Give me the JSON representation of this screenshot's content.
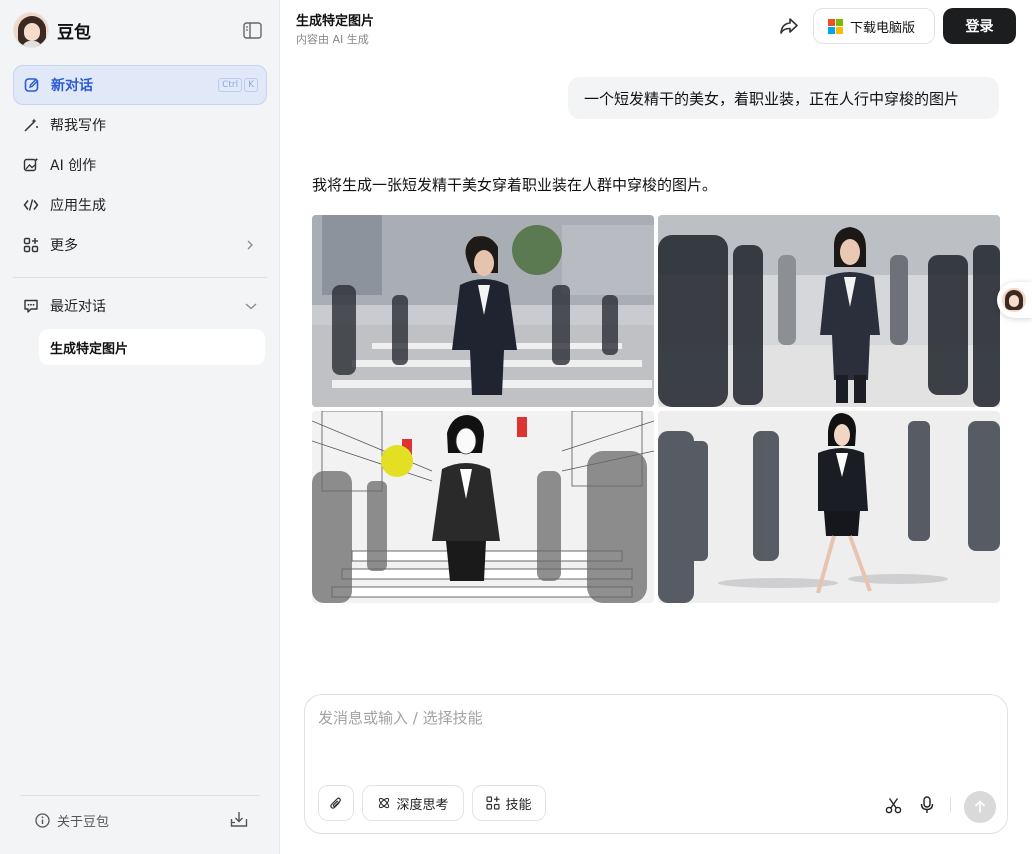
{
  "app": {
    "name": "豆包"
  },
  "sidebar": {
    "items": [
      {
        "label": "新对话",
        "icon": "new-chat-icon",
        "active": true,
        "shortcut": [
          "Ctrl",
          "K"
        ]
      },
      {
        "label": "帮我写作",
        "icon": "writing-wand-icon"
      },
      {
        "label": "AI 创作",
        "icon": "image-create-icon"
      },
      {
        "label": "应用生成",
        "icon": "code-icon"
      },
      {
        "label": "更多",
        "icon": "grid-plus-icon"
      }
    ],
    "recent_label": "最近对话",
    "recent_items": [
      {
        "label": "生成特定图片",
        "selected": true
      }
    ],
    "about_label": "关于豆包"
  },
  "header": {
    "title": "生成特定图片",
    "subtitle": "内容由 AI 生成",
    "download_label": "下载电脑版",
    "login_label": "登录"
  },
  "chat": {
    "user_message": "一个短发精干的美女，着职业装，正在人行中穿梭的图片",
    "assistant_message": "我将生成一张短发精干美女穿着职业装在人群中穿梭的图片。",
    "images_count": 4
  },
  "composer": {
    "placeholder": "发消息或输入 / 选择技能",
    "value": "",
    "deep_think_label": "深度思考",
    "skills_label": "技能"
  },
  "colors": {
    "accent": "#2a5bd7",
    "active_bg": "#e1e8f7",
    "login_bg": "#1c1d1f",
    "sidebar_bg": "#f3f4f6"
  }
}
